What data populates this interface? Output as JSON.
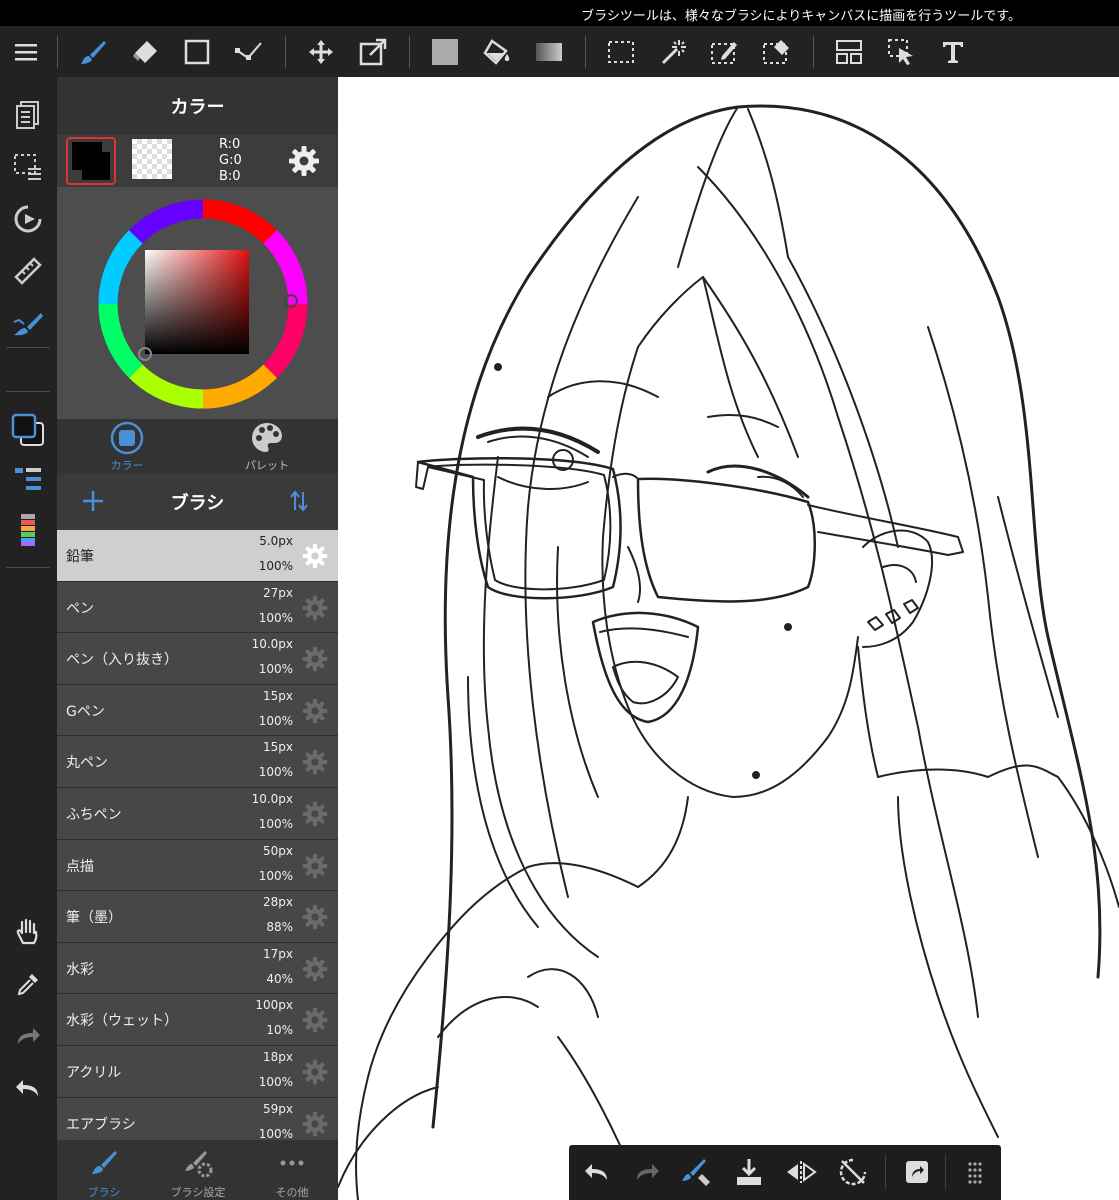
{
  "status": {
    "tooltip": "ブラシツールは、様々なブラシによりキャンバスに描画を行うツールです。"
  },
  "toolbar": {
    "icons": [
      "menu-icon",
      "brush-tool-icon",
      "eraser-tool-icon",
      "rect-shape-icon",
      "vector-tool-icon",
      "move-icon",
      "transform-icon",
      "fill-color-icon",
      "bucket-icon",
      "gradient-icon",
      "select-rect-icon",
      "magic-wand-icon",
      "select-pen-icon",
      "select-eraser-icon",
      "layout-icon",
      "select-move-icon",
      "text-icon"
    ]
  },
  "sidebar": {
    "icons": [
      "layers-icon",
      "selection-menu-icon",
      "rotate-icon",
      "ruler-icon",
      "brush-pen-icon",
      "color-swatch-icon",
      "brush-list-icon",
      "gradient-bar-icon",
      "hand-icon",
      "eyedropper-icon",
      "redo-icon",
      "undo-icon"
    ]
  },
  "color_panel": {
    "title": "カラー",
    "foreground": "#000000",
    "rgb": {
      "r": "R:0",
      "g": "G:0",
      "b": "B:0"
    },
    "tabs": [
      {
        "label": "カラー"
      },
      {
        "label": "パレット"
      }
    ]
  },
  "brush_panel": {
    "title": "ブラシ",
    "brushes": [
      {
        "name": "鉛筆",
        "size": "5.0px",
        "opacity": "100%",
        "selected": true
      },
      {
        "name": "ペン",
        "size": "27px",
        "opacity": "100%"
      },
      {
        "name": "ペン（入り抜き）",
        "size": "10.0px",
        "opacity": "100%"
      },
      {
        "name": "Gペン",
        "size": "15px",
        "opacity": "100%"
      },
      {
        "name": "丸ペン",
        "size": "15px",
        "opacity": "100%"
      },
      {
        "name": "ふちペン",
        "size": "10.0px",
        "opacity": "100%"
      },
      {
        "name": "点描",
        "size": "50px",
        "opacity": "100%"
      },
      {
        "name": "筆（墨）",
        "size": "28px",
        "opacity": "88%"
      },
      {
        "name": "水彩",
        "size": "17px",
        "opacity": "40%"
      },
      {
        "name": "水彩（ウェット）",
        "size": "100px",
        "opacity": "10%"
      },
      {
        "name": "アクリル",
        "size": "18px",
        "opacity": "100%"
      },
      {
        "name": "エアブラシ",
        "size": "59px",
        "opacity": "100%"
      }
    ],
    "bottom_tabs": [
      {
        "label": "ブラシ"
      },
      {
        "label": "ブラシ設定"
      },
      {
        "label": "その他"
      }
    ]
  },
  "canvas": {
    "background": "#ffffff"
  },
  "accent_color": "#4a90d9"
}
